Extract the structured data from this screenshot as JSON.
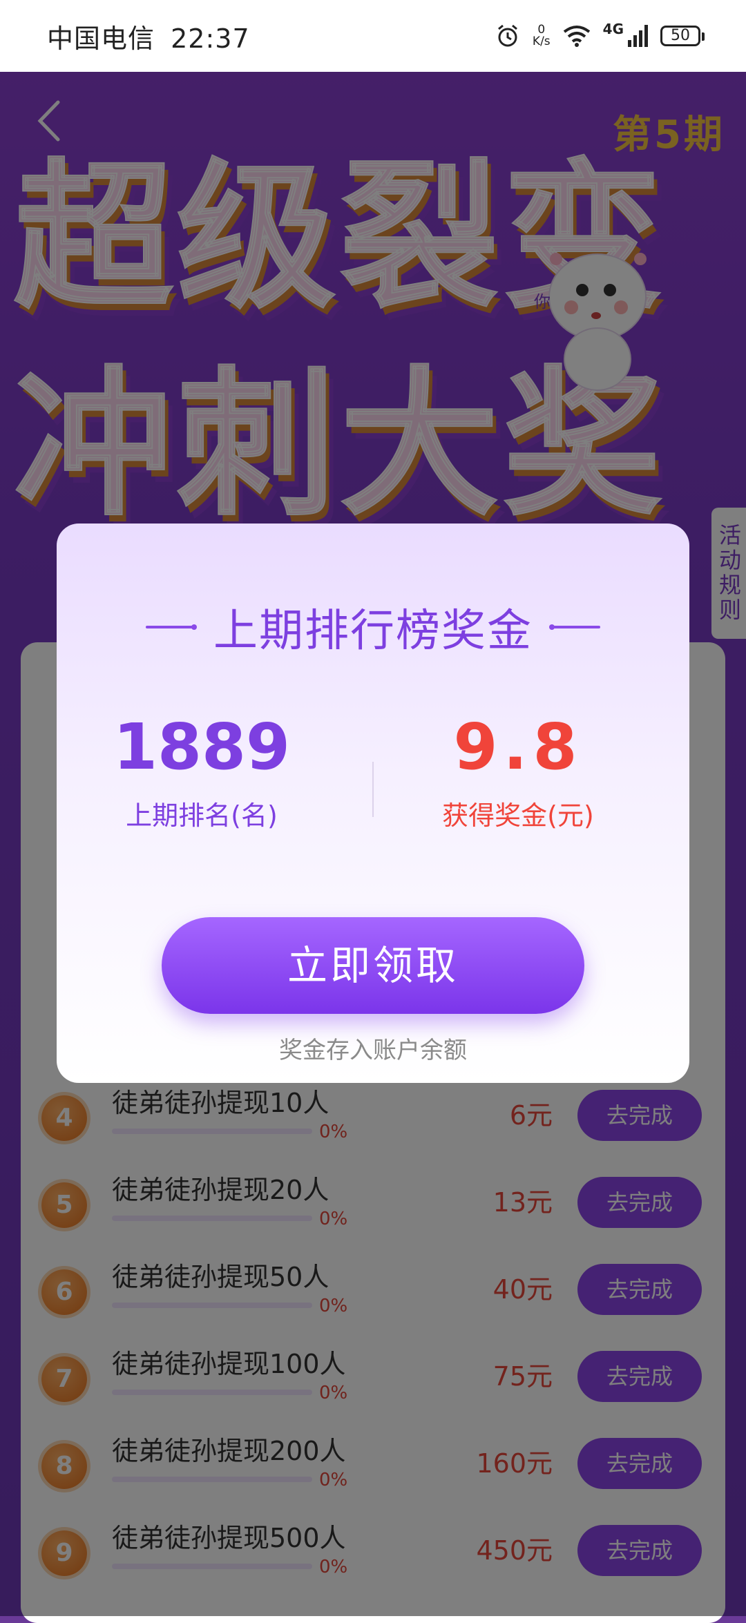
{
  "status_bar": {
    "carrier": "中国电信",
    "time": "22:37",
    "net_speed_value": "0",
    "net_speed_unit": "K/s",
    "network": "4G",
    "battery": "50"
  },
  "header": {
    "issue": "第5期",
    "hero_line1": "超级裂变",
    "hero_line2": "冲刺大奖",
    "mascot_text": "你",
    "rules_tab": "活动规则"
  },
  "tasks": [
    {
      "num": "4",
      "title": "徒弟徒孙提现10人",
      "progress": "0%",
      "reward": "6元",
      "action": "去完成"
    },
    {
      "num": "5",
      "title": "徒弟徒孙提现20人",
      "progress": "0%",
      "reward": "13元",
      "action": "去完成"
    },
    {
      "num": "6",
      "title": "徒弟徒孙提现50人",
      "progress": "0%",
      "reward": "40元",
      "action": "去完成"
    },
    {
      "num": "7",
      "title": "徒弟徒孙提现100人",
      "progress": "0%",
      "reward": "75元",
      "action": "去完成"
    },
    {
      "num": "8",
      "title": "徒弟徒孙提现200人",
      "progress": "0%",
      "reward": "160元",
      "action": "去完成"
    },
    {
      "num": "9",
      "title": "徒弟徒孙提现500人",
      "progress": "0%",
      "reward": "450元",
      "action": "去完成"
    }
  ],
  "modal": {
    "title": "上期排行榜奖金",
    "rank_value": "1889",
    "rank_label": "上期排名(名)",
    "bonus_value": "9.8",
    "bonus_label": "获得奖金(元)",
    "claim_button": "立即领取",
    "note": "奖金存入账户余额"
  }
}
